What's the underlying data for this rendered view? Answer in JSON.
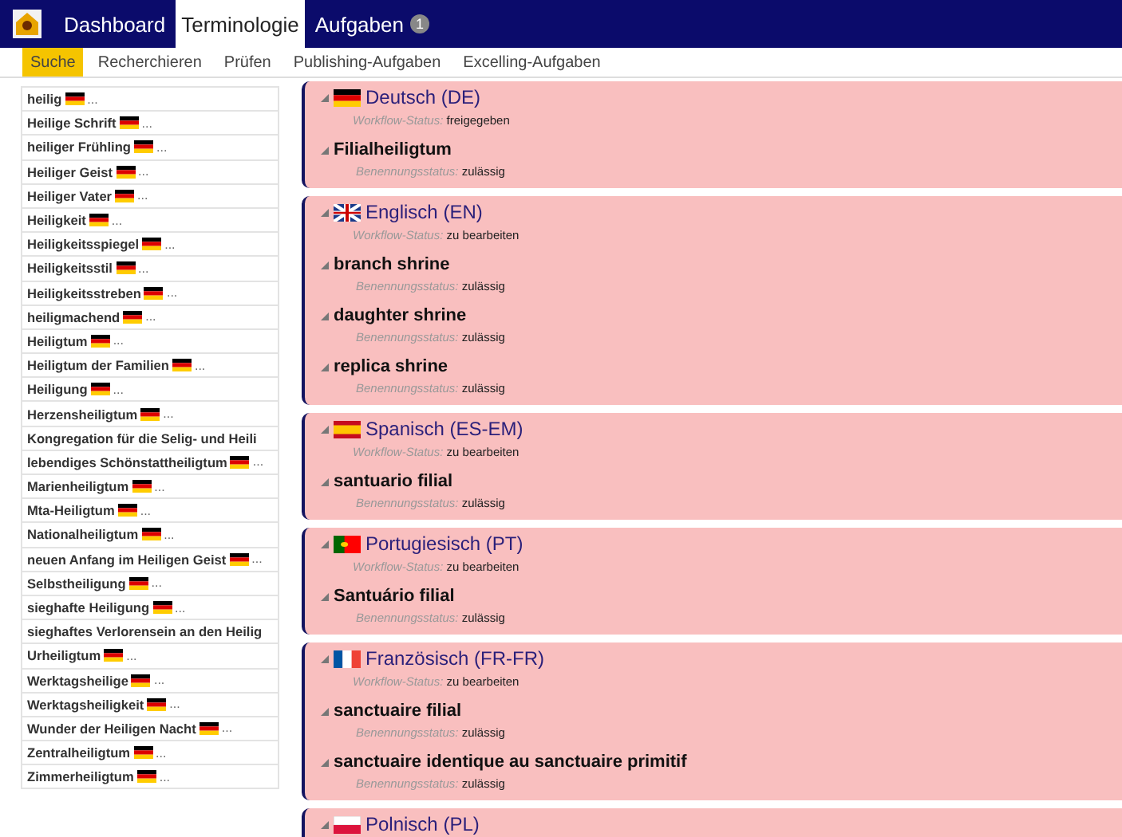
{
  "nav": {
    "tabs": [
      {
        "label": "Dashboard",
        "selected": false
      },
      {
        "label": "Terminologie",
        "selected": true
      },
      {
        "label": "Aufgaben",
        "selected": false,
        "badge": "1"
      }
    ]
  },
  "subnav": {
    "tabs": [
      {
        "label": "Suche",
        "selected": true
      },
      {
        "label": "Recherchieren",
        "selected": false
      },
      {
        "label": "Prüfen",
        "selected": false
      },
      {
        "label": "Publishing-Aufgaben",
        "selected": false
      },
      {
        "label": "Excelling-Aufgaben",
        "selected": false
      }
    ]
  },
  "results": [
    {
      "text": "heilig",
      "kind": "de",
      "more": "..."
    },
    {
      "text": "Heilige Schrift",
      "kind": "de",
      "more": "..."
    },
    {
      "text": "heiliger Frühling",
      "kind": "de",
      "more": "..."
    },
    {
      "text": "Heiliger Geist",
      "kind": "de",
      "more": "..."
    },
    {
      "text": "Heiliger Vater",
      "kind": "de",
      "more": "..."
    },
    {
      "text": "Heiligkeit",
      "kind": "de",
      "more": "..."
    },
    {
      "text": "Heiligkeitsspiegel",
      "kind": "de",
      "more": "..."
    },
    {
      "text": "Heiligkeitsstil",
      "kind": "de",
      "more": "..."
    },
    {
      "text": "Heiligkeitsstreben",
      "kind": "de",
      "more": "..."
    },
    {
      "text": "heiligmachend",
      "kind": "de",
      "more": "..."
    },
    {
      "text": "Heiligtum",
      "kind": "de",
      "more": "..."
    },
    {
      "text": "Heiligtum der Familien",
      "kind": "de",
      "more": "..."
    },
    {
      "text": "Heiligung",
      "kind": "de",
      "more": "..."
    },
    {
      "text": "Herzensheiligtum",
      "kind": "de",
      "more": "..."
    },
    {
      "text": "Kongregation für die Selig- und Heili"
    },
    {
      "text": "lebendiges Schönstattheiligtum",
      "kind": "de",
      "more": "..."
    },
    {
      "text": "Marienheiligtum",
      "kind": "de",
      "more": "..."
    },
    {
      "text": "Mta-Heiligtum",
      "kind": "de",
      "more": "..."
    },
    {
      "text": "Nationalheiligtum",
      "kind": "de",
      "more": "..."
    },
    {
      "text": "neuen Anfang im Heiligen Geist",
      "kind": "de",
      "more": "..."
    },
    {
      "text": "Selbstheiligung",
      "kind": "de",
      "more": "..."
    },
    {
      "text": "sieghafte Heiligung",
      "kind": "de",
      "more": "..."
    },
    {
      "text": "sieghaftes Verlorensein an den Heilig"
    },
    {
      "text": "Urheiligtum",
      "kind": "de",
      "more": "..."
    },
    {
      "text": "Werktagsheilige",
      "kind": "de",
      "more": "..."
    },
    {
      "text": "Werktagsheiligkeit",
      "kind": "de",
      "more": "..."
    },
    {
      "text": "Wunder der Heiligen Nacht",
      "kind": "de",
      "more": "..."
    },
    {
      "text": "Zentralheiligtum",
      "kind": "de",
      "more": "..."
    },
    {
      "text": "Zimmerheiligtum",
      "kind": "de",
      "more": "..."
    }
  ],
  "languages": [
    {
      "name": "Deutsch (DE)",
      "kind": "de",
      "expanded": true,
      "workflow_label": "Workflow-Status:",
      "workflow_status": "freigegeben",
      "terms": [
        {
          "term": "Filialheiligtum",
          "expanded": true,
          "status_label": "Benennungsstatus:",
          "status": "zulässig"
        }
      ]
    },
    {
      "name": "Englisch (EN)",
      "kind": "gb",
      "expanded": true,
      "workflow_label": "Workflow-Status:",
      "workflow_status": "zu bearbeiten",
      "terms": [
        {
          "term": "branch shrine",
          "expanded": true,
          "status_label": "Benennungsstatus:",
          "status": "zulässig"
        },
        {
          "term": "daughter shrine",
          "expanded": true,
          "status_label": "Benennungsstatus:",
          "status": "zulässig"
        },
        {
          "term": "replica shrine",
          "expanded": true,
          "status_label": "Benennungsstatus:",
          "status": "zulässig"
        }
      ]
    },
    {
      "name": "Spanisch (ES-EM)",
      "kind": "es",
      "expanded": true,
      "workflow_label": "Workflow-Status:",
      "workflow_status": "zu bearbeiten",
      "terms": [
        {
          "term": "santuario filial",
          "expanded": true,
          "status_label": "Benennungsstatus:",
          "status": "zulässig"
        }
      ]
    },
    {
      "name": "Portugiesisch (PT)",
      "kind": "pt",
      "expanded": true,
      "workflow_label": "Workflow-Status:",
      "workflow_status": "zu bearbeiten",
      "terms": [
        {
          "term": "Santuário filial",
          "expanded": true,
          "status_label": "Benennungsstatus:",
          "status": "zulässig"
        }
      ]
    },
    {
      "name": "Französisch (FR-FR)",
      "kind": "fr",
      "expanded": true,
      "workflow_label": "Workflow-Status:",
      "workflow_status": "zu bearbeiten",
      "terms": [
        {
          "term": "sanctuaire filial",
          "expanded": true,
          "status_label": "Benennungsstatus:",
          "status": "zulässig"
        },
        {
          "term": "sanctuaire identique au sanctuaire primitif",
          "expanded": true,
          "status_label": "Benennungsstatus:",
          "status": "zulässig"
        }
      ]
    },
    {
      "name": "Polnisch (PL)",
      "kind": "pl",
      "expanded": true
    }
  ]
}
